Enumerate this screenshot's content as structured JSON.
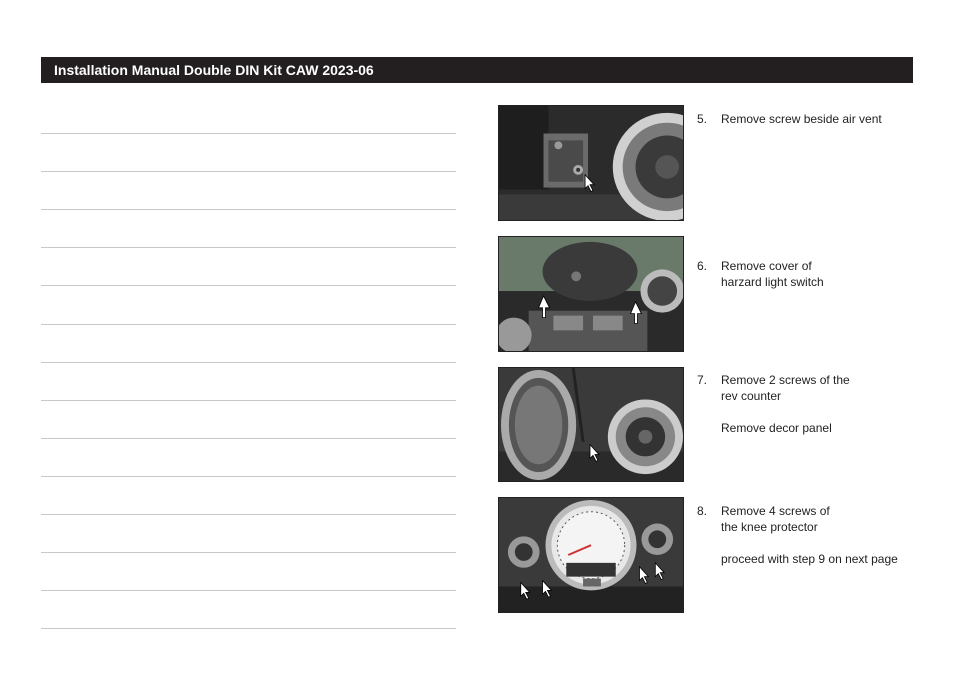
{
  "header": {
    "title": "Installation Manual Double DIN Kit CAW 2023-06"
  },
  "notes": {
    "line_count": 14
  },
  "steps": [
    {
      "number": "5.",
      "lines": [
        "Remove screw beside air vent"
      ],
      "photo_icon": "dashboard-screw-air-vent-photo"
    },
    {
      "number": "6.",
      "lines": [
        "Remove cover of",
        "harzard light switch"
      ],
      "photo_icon": "hazard-switch-cover-photo"
    },
    {
      "number": "7.",
      "lines": [
        "Remove 2 screws of the",
        "rev counter",
        "",
        "Remove decor panel"
      ],
      "photo_icon": "rev-counter-screws-photo"
    },
    {
      "number": "8.",
      "lines": [
        "Remove 4 screws of",
        "the knee protector",
        "",
        "proceed with step 9 on next page"
      ],
      "photo_icon": "knee-protector-screws-photo"
    }
  ]
}
